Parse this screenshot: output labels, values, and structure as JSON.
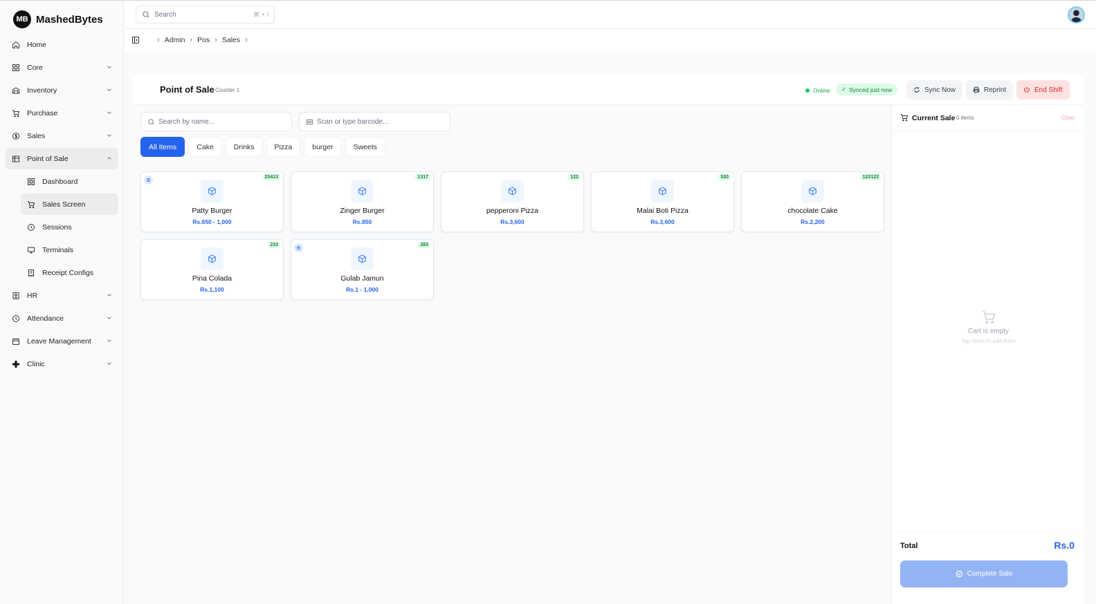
{
  "brand": {
    "logo": "MB",
    "name": "MashedBytes"
  },
  "sidebar": {
    "items": [
      {
        "label": "Home",
        "icon": "home-icon"
      },
      {
        "label": "Core",
        "icon": "grid-icon"
      },
      {
        "label": "Inventory",
        "icon": "warehouse-icon"
      },
      {
        "label": "Purchase",
        "icon": "cart-icon"
      },
      {
        "label": "Sales",
        "icon": "dollar-icon"
      },
      {
        "label": "Point of Sale",
        "icon": "store-icon"
      },
      {
        "label": "HR",
        "icon": "id-badge-icon"
      },
      {
        "label": "Attendance",
        "icon": "clock-icon"
      },
      {
        "label": "Leave Management",
        "icon": "calendar-icon"
      },
      {
        "label": "Clinic",
        "icon": "plus-icon"
      }
    ],
    "pos_sub": [
      {
        "label": "Dashboard",
        "icon": "dashboard-icon"
      },
      {
        "label": "Sales Screen",
        "icon": "cart-icon"
      },
      {
        "label": "Sessions",
        "icon": "clock-icon"
      },
      {
        "label": "Terminals",
        "icon": "monitor-icon"
      },
      {
        "label": "Receipt Configs",
        "icon": "receipt-icon"
      }
    ]
  },
  "topbar": {
    "search_placeholder": "Search",
    "shortcut": "⌘ + /"
  },
  "breadcrumb": [
    "Admin",
    "Pos",
    "Sales"
  ],
  "pos": {
    "title": "Point of Sale",
    "counter": "Counter 1",
    "online": "Online",
    "synced": "Synced just now",
    "sync_now": "Sync Now",
    "reprint": "Reprint",
    "end_shift": "End Shift",
    "search_placeholder": "Search by name...",
    "barcode_placeholder": "Scan or type barcode..."
  },
  "categories": [
    "All Items",
    "Cake",
    "Drinks",
    "Pizza",
    "burger",
    "Sweets"
  ],
  "products": [
    {
      "name": "Patty Burger",
      "price": "Rs.650 - 1,000",
      "stock": "23413",
      "has_variants": true
    },
    {
      "name": "Zinger Burger",
      "price": "Rs.850",
      "stock": "1317",
      "has_variants": false
    },
    {
      "name": "pepperoni Pizza",
      "price": "Rs.3,600",
      "stock": "122",
      "has_variants": false
    },
    {
      "name": "Malai Boti Pizza",
      "price": "Rs.3,600",
      "stock": "520",
      "has_variants": false
    },
    {
      "name": "chocolate Cake",
      "price": "Rs.2,200",
      "stock": "123122",
      "has_variants": false
    },
    {
      "name": "Pina Colada",
      "price": "Rs.1,100",
      "stock": "233",
      "has_variants": false
    },
    {
      "name": "Gulab Jamun",
      "price": "Rs.1 - 1,000",
      "stock": "283",
      "has_variants": true
    }
  ],
  "cart": {
    "title": "Current Sale",
    "count": "0 items",
    "clear": "Clear",
    "empty_title": "Cart is empty",
    "empty_hint": "Tap items to add them",
    "total_label": "Total",
    "total_value": "Rs.0",
    "complete": "Complete Sale"
  },
  "colors": {
    "accent": "#2563eb",
    "success": "#16a34a",
    "danger": "#dc2626"
  }
}
